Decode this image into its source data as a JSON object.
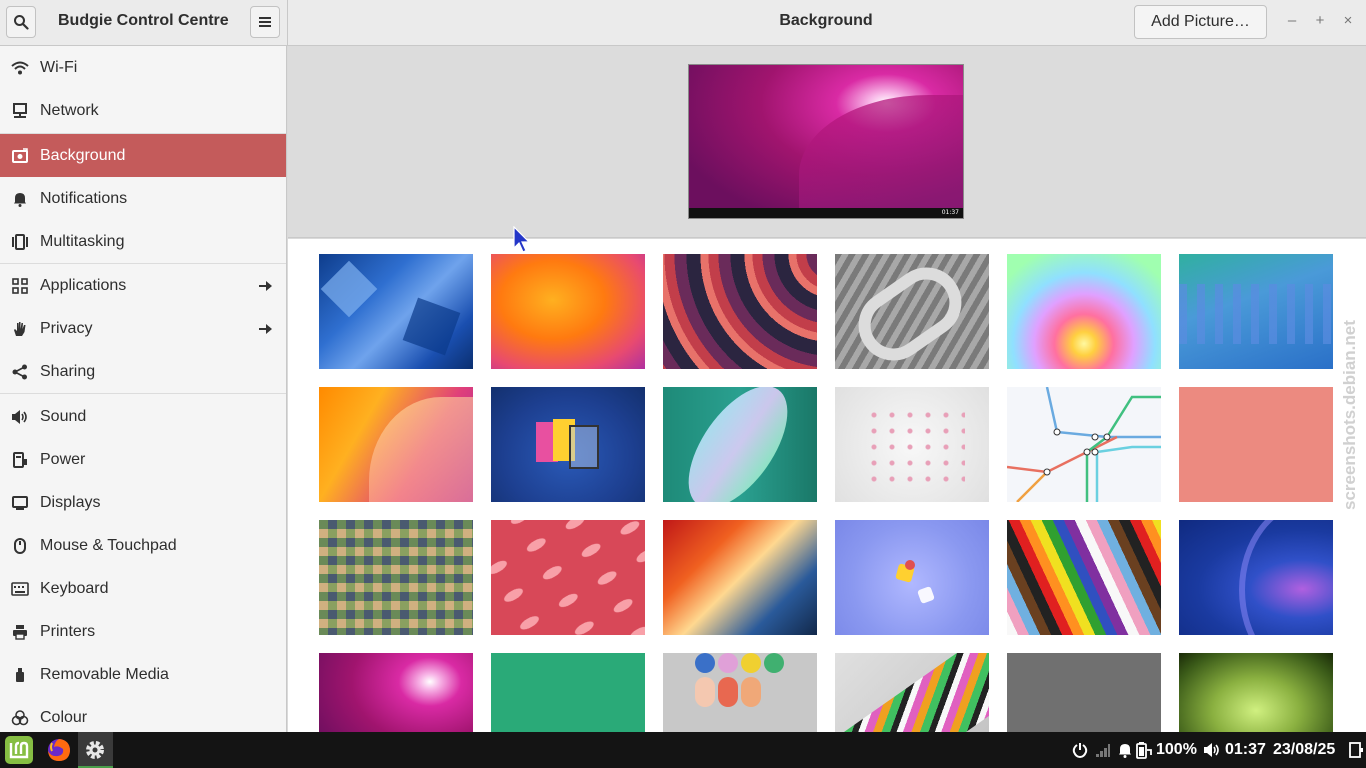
{
  "header": {
    "app_title": "Budgie Control Centre",
    "page_title": "Background",
    "add_picture_label": "Add Picture…",
    "minimize": "–",
    "maximize": "+",
    "close": "×"
  },
  "sidebar": {
    "items": [
      {
        "label": "Wi-Fi",
        "icon": "wifi-icon"
      },
      {
        "label": "Network",
        "icon": "network-icon"
      },
      {
        "label": "Background",
        "icon": "background-icon",
        "selected": true
      },
      {
        "label": "Notifications",
        "icon": "bell-icon"
      },
      {
        "label": "Multitasking",
        "icon": "multitasking-icon"
      },
      {
        "label": "Applications",
        "icon": "apps-grid-icon",
        "submenu": true
      },
      {
        "label": "Privacy",
        "icon": "hand-icon",
        "submenu": true
      },
      {
        "label": "Sharing",
        "icon": "share-icon"
      },
      {
        "label": "Sound",
        "icon": "speaker-icon"
      },
      {
        "label": "Power",
        "icon": "power-plug-icon"
      },
      {
        "label": "Displays",
        "icon": "display-icon"
      },
      {
        "label": "Mouse & Touchpad",
        "icon": "mouse-icon"
      },
      {
        "label": "Keyboard",
        "icon": "keyboard-icon"
      },
      {
        "label": "Printers",
        "icon": "printer-icon"
      },
      {
        "label": "Removable Media",
        "icon": "usb-icon"
      },
      {
        "label": "Colour",
        "icon": "palette-icon"
      }
    ]
  },
  "preview": {
    "clock": "01:37"
  },
  "watermark": "screenshots.debian.net",
  "taskbar": {
    "battery": "100%",
    "time": "01:37",
    "date": "23/08/25"
  },
  "colors": {
    "accent": "#c45b5b",
    "taskbar": "#141414"
  }
}
